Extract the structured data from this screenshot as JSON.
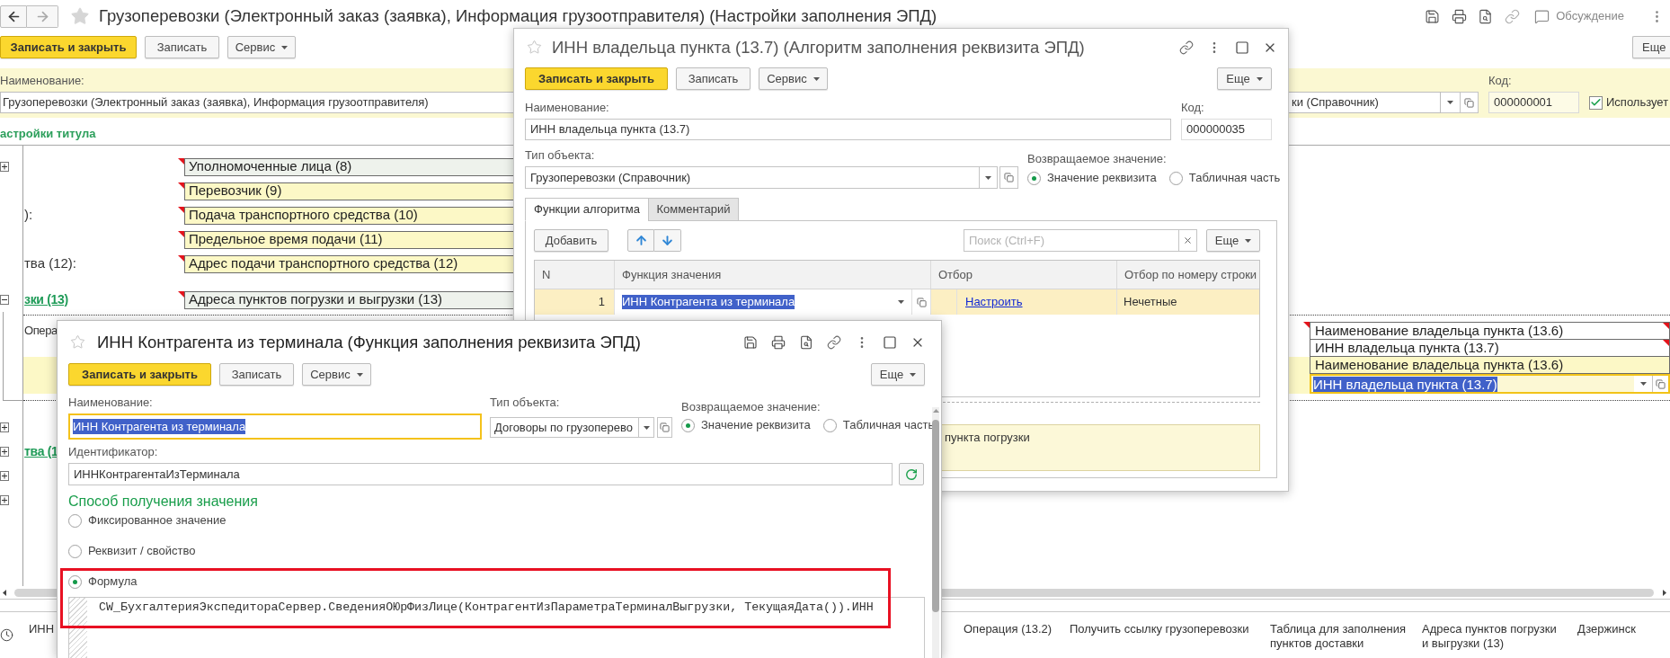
{
  "main_window": {
    "navigation": [
      {
        "kind": "back",
        "disabled": false
      },
      {
        "kind": "forward",
        "disabled": true
      }
    ],
    "title": "Грузоперевозки (Электронный заказ (заявка), Информация грузоотправителя) (Настройки заполнения ЭПД)",
    "discussion": "Обсуждение",
    "toolbar": [
      {
        "label": "Записать и закрыть",
        "kind": "primary"
      },
      {
        "label": "Записать",
        "kind": "plain"
      },
      {
        "label": "Сервис",
        "kind": "menu"
      }
    ],
    "more_button": "Еще",
    "name_label": "Наименование:",
    "name_value": "Грузоперевозки (Электронный заказ (заявка), Информация грузоотправителя)",
    "type_value": "ки (Справочник)",
    "code_label": "Код:",
    "code_value": "000000001",
    "in_use": {
      "label": "Использует",
      "checked": true
    },
    "section_title": "астройки титула",
    "tree": [
      {
        "kind": "group",
        "expanded": false,
        "cell": {
          "text": "Уполномоченные лица (8)",
          "highlighted": false,
          "flag_left": true
        }
      },
      {
        "kind": "field",
        "cell": {
          "text": "Перевозчик (9)",
          "highlighted": true,
          "flag_left": true
        }
      },
      {
        "kind": "field",
        "caption": "):",
        "cell": {
          "text": "Подача транспортного средства (10)",
          "highlighted": true,
          "flag_left": true
        }
      },
      {
        "kind": "field",
        "cell": {
          "text": "Предельное время подачи (11)",
          "highlighted": true,
          "flag_left": true
        }
      },
      {
        "kind": "field",
        "caption": "тва (12):",
        "cell": {
          "text": "Адрес подачи транспортного средства (12)",
          "highlighted": true,
          "flag_left": true
        }
      },
      {
        "kind": "group",
        "expanded": true,
        "caption": "зки (13)",
        "cell": {
          "text": "Адреса пунктов погрузки и выгрузки (13)",
          "highlighted": false,
          "flag_left": true
        },
        "children": [
          {
            "caption": "Опера",
            "highlighted": false,
            "cells": [
              {
                "kind": "cell",
                "text": "Наименование владельца пункта (13.6)",
                "flag_left": true,
                "flag_right": true
              },
              {
                "kind": "cell",
                "text": "ИНН владельца пункта (13.7)",
                "flag_left": false,
                "flag_right": true
              }
            ]
          },
          {
            "highlighted": true,
            "cells": [
              {
                "kind": "cell",
                "text": "Наименование владельца пункта (13.6)",
                "flag_left": false,
                "flag_right": false
              },
              {
                "kind": "editor",
                "text": "ИНН владельца пункта (13.7)",
                "flag_left": false,
                "flag_right": false
              }
            ]
          }
        ]
      },
      {
        "kind": "group",
        "expanded": false
      },
      {
        "kind": "group",
        "expanded": false,
        "caption": "тва (1"
      },
      {
        "kind": "group",
        "expanded": false
      },
      {
        "kind": "group",
        "expanded": false
      }
    ],
    "bottom_row": {
      "first_cell": "ИНН",
      "cells": [
        "Операция (13.2)",
        "Получить ссылку грузоперевозки",
        "Таблица для заполнения пунктов доставки",
        "Адреса пунктов погрузки и выгрузки (13)",
        "Дзержинск"
      ]
    }
  },
  "algorithm_window": {
    "active": false,
    "title": "ИНН владельца пункта (13.7) (Алгоритм заполнения реквизита ЭПД)",
    "toolbar": [
      {
        "label": "Записать и закрыть",
        "kind": "primary"
      },
      {
        "label": "Записать",
        "kind": "plain"
      },
      {
        "label": "Сервис",
        "kind": "menu"
      }
    ],
    "more_button": "Еще",
    "name_label": "Наименование:",
    "name_value": "ИНН владельца пункта (13.7)",
    "code_label": "Код:",
    "code_value": "000000035",
    "type_label": "Тип объекта:",
    "type_value": "Грузоперевозки (Справочник)",
    "return_label": "Возвращаемое значение:",
    "return_options": [
      {
        "label": "Значение реквизита",
        "selected": true
      },
      {
        "label": "Табличная часть",
        "selected": false
      }
    ],
    "tabs": [
      {
        "label": "Функции алгоритма",
        "selected": true
      },
      {
        "label": "Комментарий",
        "selected": false
      }
    ],
    "add_button": "Добавить",
    "search": {
      "placeholder": "Поиск (Ctrl+F)"
    },
    "table_more_button": "Еще",
    "table": {
      "columns": [
        "N",
        "Функция значения",
        "Отбор",
        "Отбор по номеру строки"
      ],
      "rows": [
        {
          "number": "1",
          "function": "ИНН Контрагента из терминала",
          "filter": "Настроить",
          "row_filter": "Нечетные",
          "selected": true
        }
      ]
    },
    "note": "пункта погрузки"
  },
  "function_window": {
    "active": true,
    "title": "ИНН Контрагента из терминала (Функция заполнения реквизита ЭПД)",
    "toolbar": [
      {
        "label": "Записать и закрыть",
        "kind": "primary"
      },
      {
        "label": "Записать",
        "kind": "plain"
      },
      {
        "label": "Сервис",
        "kind": "menu"
      }
    ],
    "more_button": "Еще",
    "name_label": "Наименование:",
    "name_value": "ИНН Контрагента из терминала",
    "type_label": "Тип объекта:",
    "type_value": "Договоры по грузоперево",
    "return_label": "Возвращаемое значение:",
    "return_options": [
      {
        "label": "Значение реквизита",
        "selected": true
      },
      {
        "label": "Табличная часть",
        "selected": false
      }
    ],
    "id_label": "Идентификатор:",
    "id_value": "ИННКонтрагентаИзТерминала",
    "method_title": "Способ получения значения",
    "methods": [
      {
        "label": "Фиксированное значение",
        "selected": false
      },
      {
        "label": "Реквизит / свойство",
        "selected": false
      },
      {
        "label": "Формула",
        "selected": true
      }
    ],
    "formula": "CW_БухгалтерияЭкспедитораСервер.СведенияОЮрФизЛице(КонтрагентИзПараметраТерминалВыгрузки, ТекущаяДата()).ИНН"
  }
}
